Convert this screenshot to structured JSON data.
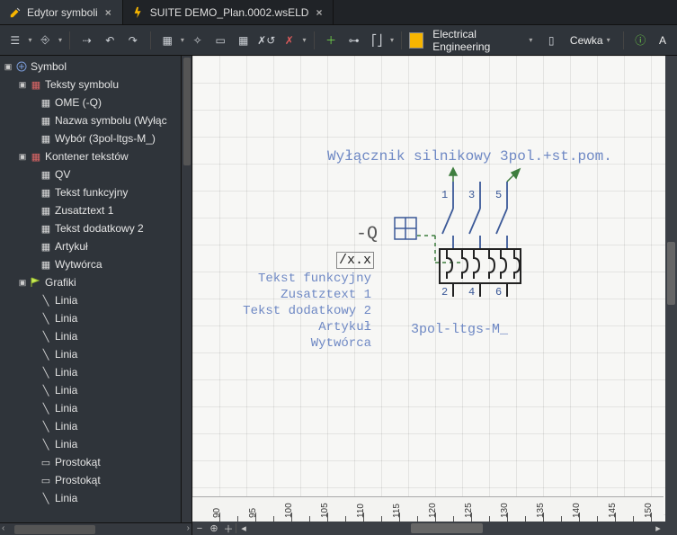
{
  "tabs": [
    {
      "label": "Edytor symboli",
      "active": true
    },
    {
      "label": "SUITE DEMO_Plan.0002.wsELD",
      "active": false
    }
  ],
  "toolbar": {
    "discipline": "Electrical Engineering",
    "coil": "Cewka",
    "letter": "A"
  },
  "tree": {
    "root": "Symbol",
    "groups": [
      {
        "label": "Teksty symbolu",
        "children": [
          {
            "label": "OME (-Q)"
          },
          {
            "label": "Nazwa symbolu (Wyłąc"
          },
          {
            "label": "Wybór (3pol-ltgs-M_)"
          }
        ]
      },
      {
        "label": "Kontener tekstów",
        "children": [
          {
            "label": "QV"
          },
          {
            "label": "Tekst funkcyjny"
          },
          {
            "label": "Zusatztext 1"
          },
          {
            "label": "Tekst dodatkowy 2"
          },
          {
            "label": "Artykuł"
          },
          {
            "label": "Wytwórca"
          }
        ]
      },
      {
        "label": "Grafiki",
        "children": [
          {
            "label": "Linia"
          },
          {
            "label": "Linia"
          },
          {
            "label": "Linia"
          },
          {
            "label": "Linia"
          },
          {
            "label": "Linia"
          },
          {
            "label": "Linia"
          },
          {
            "label": "Linia"
          },
          {
            "label": "Linia"
          },
          {
            "label": "Linia"
          },
          {
            "label": "Prostokąt"
          },
          {
            "label": "Prostokąt"
          },
          {
            "label": "Linia"
          }
        ]
      }
    ]
  },
  "canvas": {
    "title": "Wyłącznik silnikowy 3pol.+st.pom.",
    "ref": "-Q",
    "xref": "/x.x",
    "texts": [
      "Tekst funkcyjny",
      "Zusatztext 1",
      "Tekst dodatkowy 2",
      "Artykuł",
      "Wytwórca"
    ],
    "variant": "3pol-ltgs-M_",
    "pins_top": [
      "1",
      "3",
      "5"
    ],
    "pins_bottom": [
      "2",
      "4",
      "6"
    ],
    "ruler": [
      "90",
      "95",
      "100",
      "105",
      "110",
      "115",
      "120",
      "125",
      "130",
      "135",
      "140",
      "145",
      "150"
    ]
  }
}
